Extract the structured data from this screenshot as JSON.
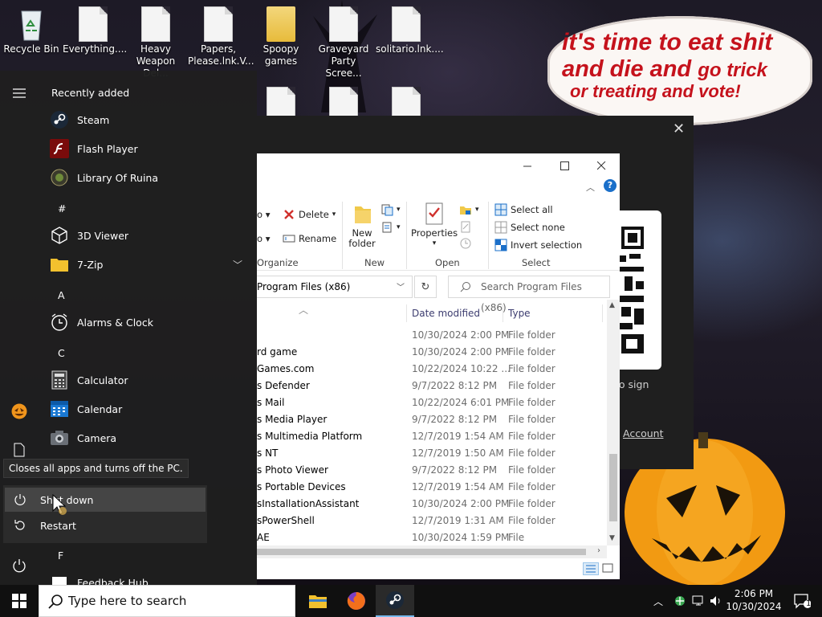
{
  "wallpaper": {
    "speech": {
      "line1": "it's time to eat shit",
      "line2a": "and die and",
      "line2b": "go trick",
      "line3": "or treating and vote!"
    }
  },
  "desktop_icons": [
    {
      "label": "Recycle Bin",
      "icon": "recycle-bin-icon"
    },
    {
      "label": "Everything....",
      "icon": "document-icon"
    },
    {
      "label": "Heavy Weapon Del...",
      "icon": "document-icon"
    },
    {
      "label": "Papers, Please.lnk.V...",
      "icon": "document-icon"
    },
    {
      "label": "Spoopy games",
      "icon": "folder-icon"
    },
    {
      "label": "Graveyard Party Scree...",
      "icon": "document-icon"
    },
    {
      "label": "solitario.lnk....",
      "icon": "document-icon"
    }
  ],
  "start_menu": {
    "recently_added_label": "Recently added",
    "recent_apps": [
      {
        "label": "Steam",
        "icon": "steam-icon"
      },
      {
        "label": "Flash Player",
        "icon": "flash-icon"
      },
      {
        "label": "Library Of Ruina",
        "icon": "library-of-ruina-icon"
      }
    ],
    "groups": {
      "hash": "#",
      "a": "A",
      "c": "C",
      "f": "F"
    },
    "apps": {
      "viewer3d": "3D Viewer",
      "zip": "7-Zip",
      "alarms": "Alarms & Clock",
      "calculator": "Calculator",
      "calendar": "Calendar",
      "camera": "Camera",
      "feedback": "Feedback Hub"
    },
    "tooltip": "Closes all apps and turns off the PC.",
    "power": {
      "shutdown": "Shut down",
      "restart": "Restart"
    }
  },
  "dark_window": {
    "sign_text": "to sign",
    "account_text": "Account"
  },
  "explorer": {
    "ribbon": {
      "delete": "Delete",
      "rename": "Rename",
      "organize": "Organize",
      "new_folder": "New folder",
      "new": "New",
      "properties": "Properties",
      "open": "Open",
      "select_all": "Select all",
      "select_none": "Select none",
      "invert_selection": "Invert selection",
      "select": "Select"
    },
    "address": "Program Files (x86)",
    "search_placeholder": "Search Program Files (x86)",
    "columns": {
      "date": "Date modified",
      "type": "Type"
    },
    "files": [
      {
        "name": "",
        "date": "10/30/2024 2:00 PM",
        "type": "File folder"
      },
      {
        "name": "rd game",
        "date": "10/30/2024 2:00 PM",
        "type": "File folder"
      },
      {
        "name": "Games.com",
        "date": "10/22/2024 10:22 ...",
        "type": "File folder"
      },
      {
        "name": "s Defender",
        "date": "9/7/2022 8:12 PM",
        "type": "File folder"
      },
      {
        "name": "s Mail",
        "date": "10/22/2024 6:01 PM",
        "type": "File folder"
      },
      {
        "name": "s Media Player",
        "date": "9/7/2022 8:12 PM",
        "type": "File folder"
      },
      {
        "name": "s Multimedia Platform",
        "date": "12/7/2019 1:54 AM",
        "type": "File folder"
      },
      {
        "name": "s NT",
        "date": "12/7/2019 1:50 AM",
        "type": "File folder"
      },
      {
        "name": "s Photo Viewer",
        "date": "9/7/2022 8:12 PM",
        "type": "File folder"
      },
      {
        "name": "s Portable Devices",
        "date": "12/7/2019 1:54 AM",
        "type": "File folder"
      },
      {
        "name": "sInstallationAssistant",
        "date": "10/30/2024 2:00 PM",
        "type": "File folder"
      },
      {
        "name": "sPowerShell",
        "date": "12/7/2019 1:31 AM",
        "type": "File folder"
      },
      {
        "name": "AE",
        "date": "10/30/2024 1:59 PM",
        "type": "File"
      }
    ]
  },
  "taskbar": {
    "search_placeholder": "Type here to search",
    "time": "2:06 PM",
    "date": "10/30/2024",
    "notification_count": "1"
  },
  "colors": {
    "accent": "#0078d7",
    "speech_red": "#c5121c",
    "pumpkin": "#f29a12"
  }
}
